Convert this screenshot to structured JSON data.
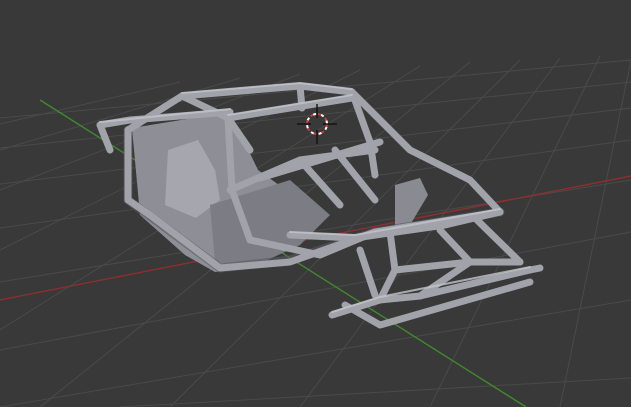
{
  "viewport": {
    "view": "3D Viewport",
    "background_color": "#393939",
    "grid_color": "#4a4a4a",
    "x_axis_color": "#8e2f2f",
    "y_axis_color": "#3f8a2b",
    "object": {
      "name": "roll-cage-frame",
      "material_color": "#9a9aa2"
    },
    "cursor": {
      "icon": "3d-cursor-icon",
      "ring_color": "#d23a3a"
    }
  }
}
